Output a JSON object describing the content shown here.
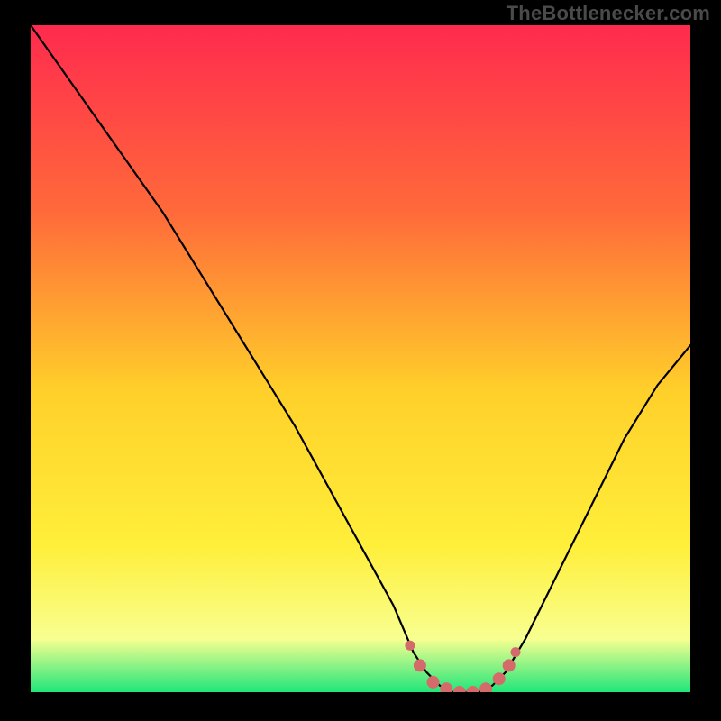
{
  "watermark": "TheBottlenecker.com",
  "colors": {
    "bg": "#000000",
    "grad_top": "#ff2a4e",
    "grad_mid1": "#ff6a3a",
    "grad_mid2": "#ffd02a",
    "grad_mid3": "#ffef3a",
    "grad_low": "#f8ff90",
    "grad_bottom": "#20e67a",
    "curve": "#000000",
    "marker": "#d46a6a"
  },
  "chart_data": {
    "type": "line",
    "title": "",
    "xlabel": "",
    "ylabel": "",
    "xlim": [
      0,
      100
    ],
    "ylim": [
      0,
      100
    ],
    "series": [
      {
        "name": "bottleneck-curve",
        "x": [
          0,
          5,
          10,
          15,
          20,
          25,
          30,
          35,
          40,
          45,
          50,
          55,
          58,
          60,
          62,
          64,
          66,
          68,
          70,
          72,
          75,
          80,
          85,
          90,
          95,
          100
        ],
        "y": [
          100,
          93,
          86,
          79,
          72,
          64,
          56,
          48,
          40,
          31,
          22,
          13,
          6,
          3,
          1,
          0,
          0,
          0,
          1,
          3,
          8,
          18,
          28,
          38,
          46,
          52
        ]
      }
    ],
    "markers": {
      "name": "highlight-dots",
      "points": [
        {
          "x": 57.5,
          "y": 7
        },
        {
          "x": 59,
          "y": 4
        },
        {
          "x": 61,
          "y": 1.5
        },
        {
          "x": 63,
          "y": 0.5
        },
        {
          "x": 65,
          "y": 0
        },
        {
          "x": 67,
          "y": 0
        },
        {
          "x": 69,
          "y": 0.5
        },
        {
          "x": 71,
          "y": 2
        },
        {
          "x": 72.5,
          "y": 4
        },
        {
          "x": 73.5,
          "y": 6
        }
      ]
    }
  }
}
